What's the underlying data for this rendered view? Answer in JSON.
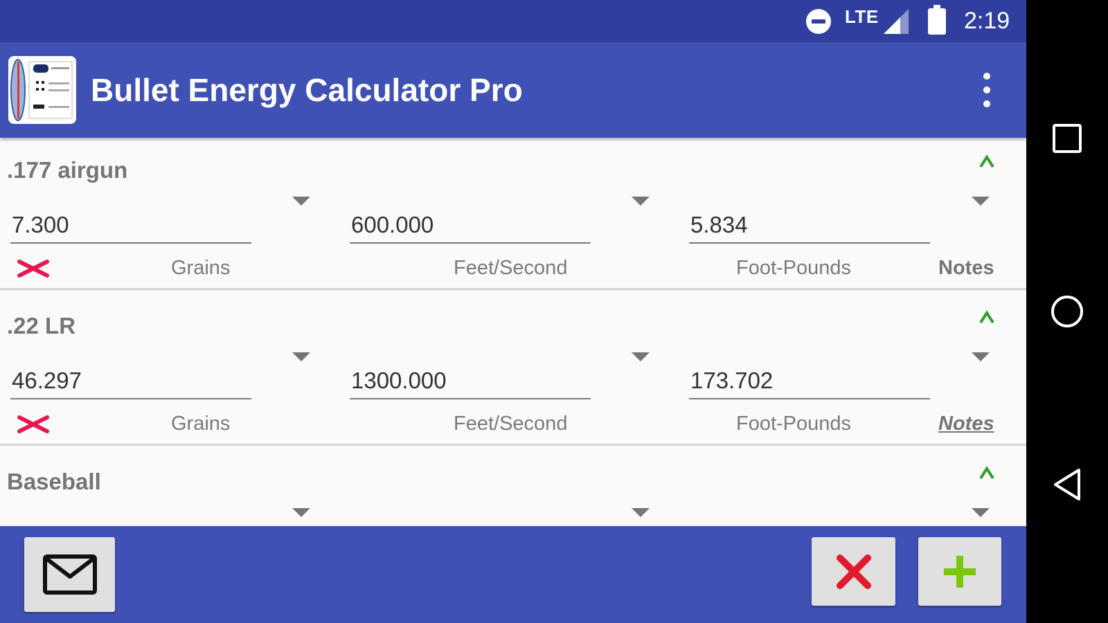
{
  "status_bar": {
    "network_label": "LTE",
    "time": "2:19",
    "icons": [
      "do-not-disturb-icon",
      "signal-icon",
      "battery-icon"
    ]
  },
  "app_bar": {
    "title": "Bullet Energy Calculator Pro",
    "icons": [
      "app-logo-icon",
      "more-vert-icon"
    ]
  },
  "cards": [
    {
      "name": ".177 airgun",
      "weight": "7.300",
      "velocity": "600.000",
      "energy": "5.834",
      "weight_unit": "Grains",
      "velocity_unit": "Feet/Second",
      "energy_unit": "Foot-Pounds",
      "notes_label": "Notes",
      "has_notes": false
    },
    {
      "name": ".22 LR",
      "weight": "46.297",
      "velocity": "1300.000",
      "energy": "173.702",
      "weight_unit": "Grains",
      "velocity_unit": "Feet/Second",
      "energy_unit": "Foot-Pounds",
      "notes_label": "Notes",
      "has_notes": true
    },
    {
      "name": "Baseball"
    }
  ],
  "bottom_bar": {
    "buttons": [
      "email-button",
      "clear-button",
      "add-button"
    ]
  },
  "nav_bar": {
    "buttons": [
      "recents-button",
      "home-button",
      "back-button"
    ]
  },
  "colors": {
    "status_bar": "#303f9f",
    "primary": "#3f51b5",
    "collapse_accent": "#2e9e2e",
    "delete_accent": "#e8174f",
    "add_accent": "#7ac70c",
    "clear_accent": "#e21a2d"
  }
}
